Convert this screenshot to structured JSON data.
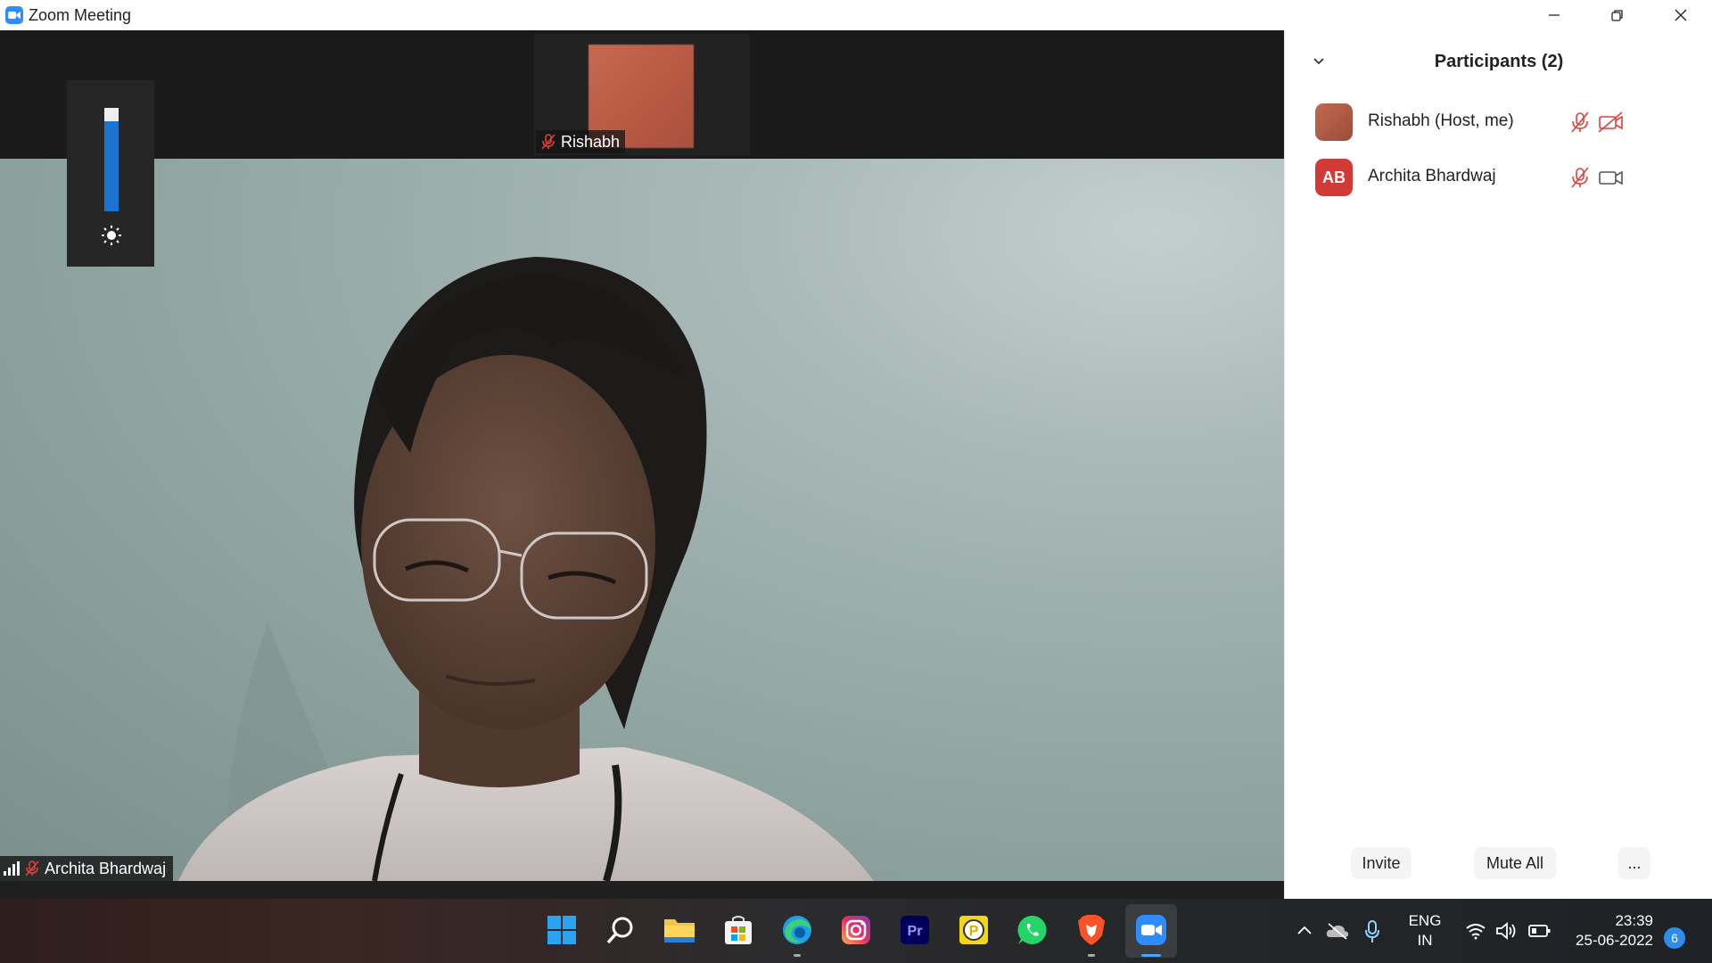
{
  "window": {
    "title": "Zoom Meeting"
  },
  "video": {
    "thumbnail_name": "Rishabh",
    "main_name": "Archita Bhardwaj"
  },
  "participants_panel": {
    "title": "Participants (2)",
    "participants": [
      {
        "name": "Rishabh (Host, me)",
        "initials": "",
        "mic": "muted",
        "video": "off"
      },
      {
        "name": "Archita Bhardwaj",
        "initials": "AB",
        "mic": "muted",
        "video": "on"
      }
    ],
    "buttons": {
      "invite": "Invite",
      "mute_all": "Mute All",
      "more": "..."
    }
  },
  "taskbar": {
    "apps": [
      "windows-start",
      "search",
      "file-explorer",
      "microsoft-store",
      "edge",
      "instagram",
      "premiere-pro",
      "pdf-reader",
      "whatsapp",
      "brave",
      "zoom"
    ],
    "language_line1": "ENG",
    "language_line2": "IN",
    "time": "23:39",
    "date": "25-06-2022",
    "notification_count": "6"
  },
  "colors": {
    "accent": "#2d8cff",
    "mute_red": "#e0403a",
    "avatar_ab": "#d13a35",
    "slider_blue": "#1b75d0"
  }
}
